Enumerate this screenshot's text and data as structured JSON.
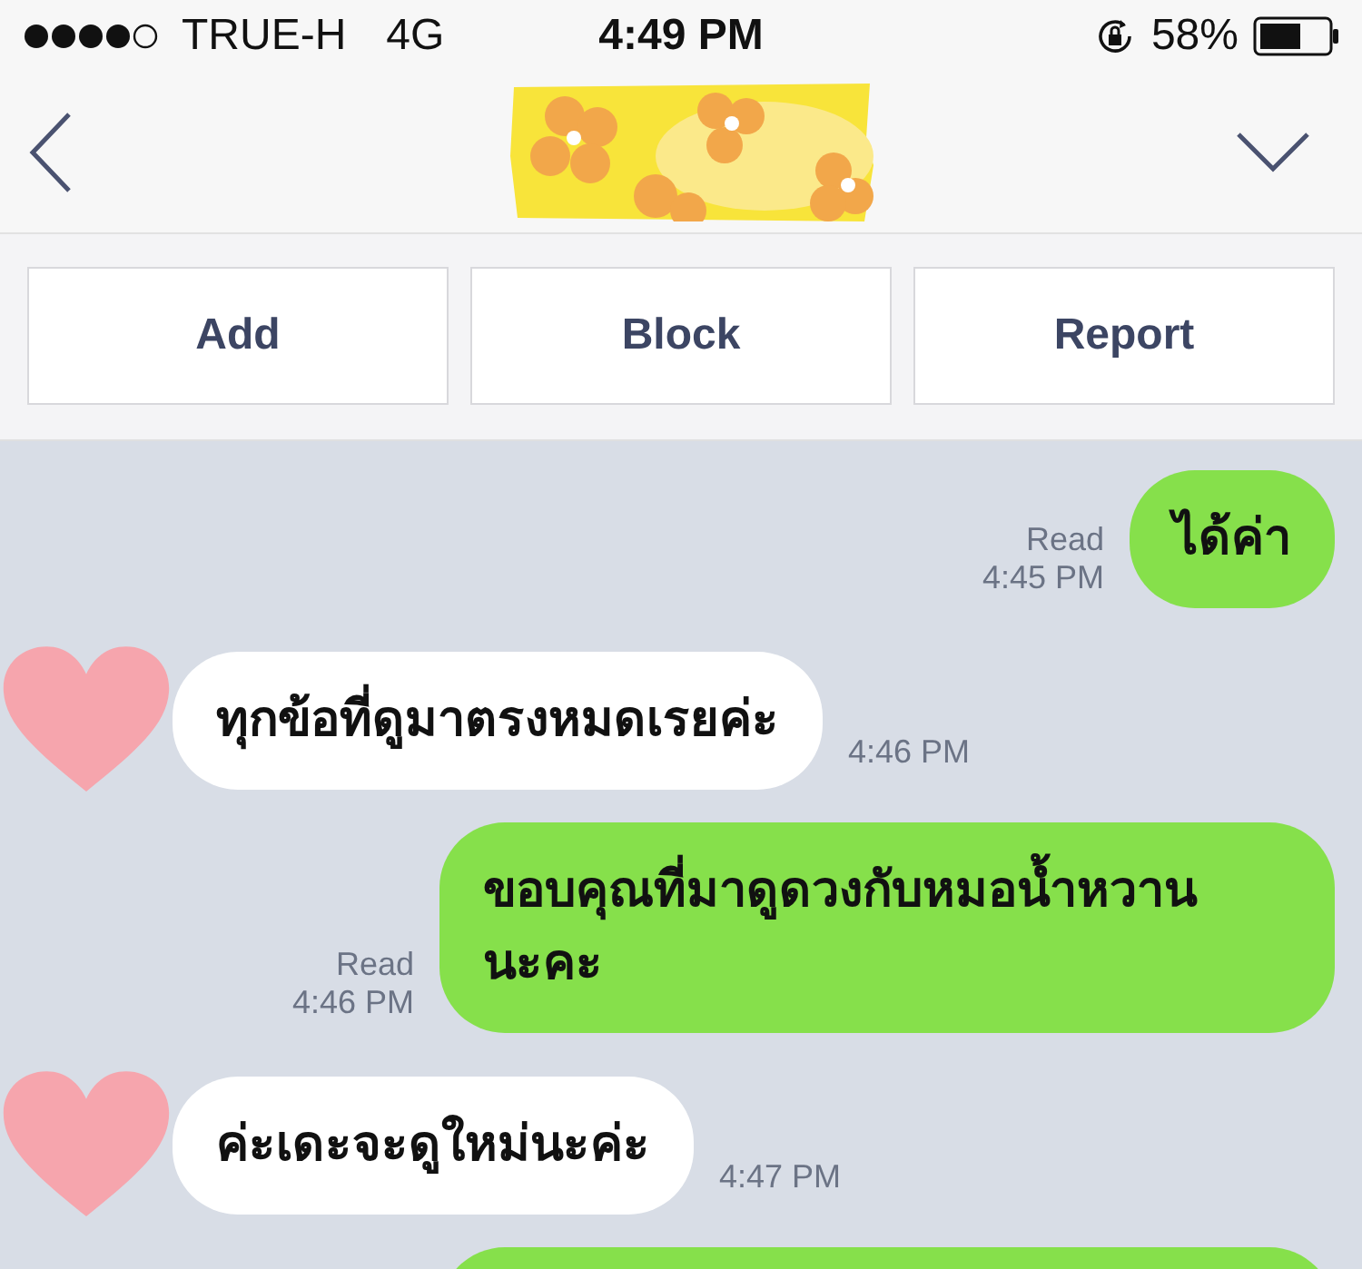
{
  "status_bar": {
    "carrier": "TRUE-H",
    "network": "4G",
    "time": "4:49 PM",
    "battery": "58%"
  },
  "actions": [
    "Add",
    "Block",
    "Report"
  ],
  "messages": [
    {
      "kind": "sent",
      "text": "ได้ค่า",
      "read": "Read",
      "time": "4:45 PM"
    },
    {
      "kind": "received",
      "text": "ทุกข้อที่ดูมาตรงหมดเรยค่ะ",
      "time": "4:46 PM"
    },
    {
      "kind": "sent",
      "text": "ขอบคุณที่มาดูดวงกับหมอน้ำหวาน นะคะ",
      "read": "Read",
      "time": "4:46 PM"
    },
    {
      "kind": "received",
      "text": "ค่ะเดะจะดูใหม่นะค่ะ",
      "time": "4:47 PM"
    },
    {
      "kind": "sent"
    }
  ]
}
